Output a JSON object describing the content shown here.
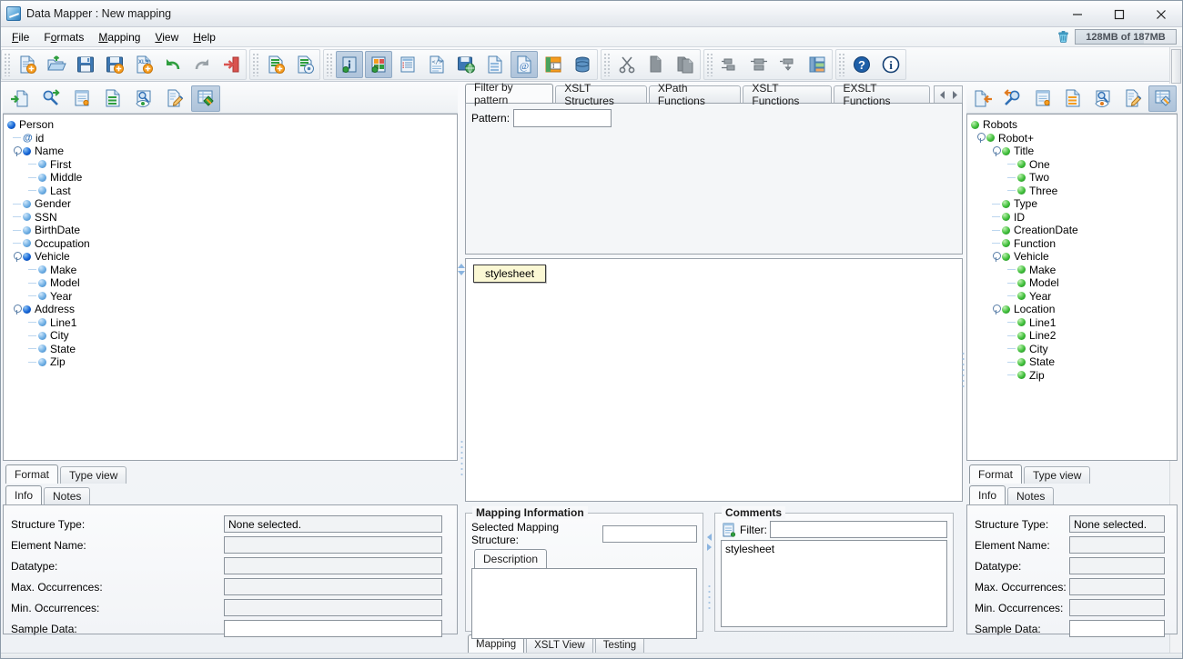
{
  "window": {
    "title": "Data Mapper : New mapping",
    "app_icon": "data-mapper-icon",
    "minimize": "minimize-icon",
    "maximize": "maximize-icon",
    "close": "close-icon"
  },
  "menubar": {
    "items": [
      {
        "label": "File",
        "mnemonic": "F"
      },
      {
        "label": "Formats",
        "mnemonic": "o"
      },
      {
        "label": "Mapping",
        "mnemonic": "M"
      },
      {
        "label": "View",
        "mnemonic": "V"
      },
      {
        "label": "Help",
        "mnemonic": "H"
      }
    ],
    "memory": {
      "text": "128MB of 187MB",
      "trash_icon": "trash-icon"
    }
  },
  "toolbar": {
    "groups": [
      {
        "buttons": [
          {
            "name": "new-mapping-icon",
            "active": false
          },
          {
            "name": "open-mapping-icon",
            "active": false
          },
          {
            "name": "save-mapping-icon",
            "active": false
          },
          {
            "name": "save-as-mapping-icon",
            "active": false
          },
          {
            "name": "export-xls-icon",
            "active": false
          },
          {
            "name": "undo-icon",
            "active": false
          },
          {
            "name": "redo-icon",
            "active": false
          },
          {
            "name": "exit-icon",
            "active": false
          }
        ]
      },
      {
        "buttons": [
          {
            "name": "add-structure-icon",
            "active": false
          },
          {
            "name": "remove-structure-icon",
            "active": false
          }
        ]
      },
      {
        "buttons": [
          {
            "name": "source-info-icon",
            "active": true
          },
          {
            "name": "target-info-icon",
            "active": true
          },
          {
            "name": "list-view-icon",
            "active": false
          },
          {
            "name": "xml-source-icon",
            "active": false
          },
          {
            "name": "save-web-icon",
            "active": false
          },
          {
            "name": "document-icon",
            "active": false
          },
          {
            "name": "at-document-icon",
            "active": true
          },
          {
            "name": "text-annotation-icon",
            "active": false
          },
          {
            "name": "database-icon",
            "active": false
          }
        ]
      },
      {
        "buttons": [
          {
            "name": "cut-icon",
            "active": false
          },
          {
            "name": "copy-icon",
            "active": false
          },
          {
            "name": "paste-icon",
            "active": false
          }
        ]
      },
      {
        "buttons": [
          {
            "name": "align-left-icon",
            "active": false
          },
          {
            "name": "align-center-icon",
            "active": false
          },
          {
            "name": "align-right-icon",
            "active": false
          },
          {
            "name": "grid-layout-icon",
            "active": false
          }
        ]
      },
      {
        "buttons": [
          {
            "name": "help-icon",
            "active": false
          },
          {
            "name": "about-icon",
            "active": false
          }
        ]
      }
    ]
  },
  "left_panel": {
    "toolbar": [
      {
        "name": "import-structure-icon",
        "active": false
      },
      {
        "name": "find-structure-icon",
        "active": false
      },
      {
        "name": "new-note-icon",
        "active": false
      },
      {
        "name": "structure-list-icon",
        "active": false
      },
      {
        "name": "preview-structure-icon",
        "active": false
      },
      {
        "name": "edit-structure-icon",
        "active": false
      },
      {
        "name": "structure-view-icon",
        "active": true
      }
    ],
    "tree": [
      {
        "label": "Person",
        "depth": 0,
        "dot": "dark-blue",
        "handle": false,
        "attr": false
      },
      {
        "label": "id",
        "depth": 1,
        "dot": "attr",
        "handle": false,
        "attr": true
      },
      {
        "label": "Name",
        "depth": 1,
        "dot": "dark-blue",
        "handle": true,
        "attr": false
      },
      {
        "label": "First",
        "depth": 2,
        "dot": "light-blue",
        "handle": false,
        "attr": false
      },
      {
        "label": "Middle",
        "depth": 2,
        "dot": "light-blue",
        "handle": false,
        "attr": false
      },
      {
        "label": "Last",
        "depth": 2,
        "dot": "light-blue",
        "handle": false,
        "attr": false
      },
      {
        "label": "Gender",
        "depth": 1,
        "dot": "light-blue",
        "handle": false,
        "attr": false
      },
      {
        "label": "SSN",
        "depth": 1,
        "dot": "light-blue",
        "handle": false,
        "attr": false
      },
      {
        "label": "BirthDate",
        "depth": 1,
        "dot": "light-blue",
        "handle": false,
        "attr": false
      },
      {
        "label": "Occupation",
        "depth": 1,
        "dot": "light-blue",
        "handle": false,
        "attr": false
      },
      {
        "label": "Vehicle",
        "depth": 1,
        "dot": "dark-blue",
        "handle": true,
        "attr": false
      },
      {
        "label": "Make",
        "depth": 2,
        "dot": "light-blue",
        "handle": false,
        "attr": false
      },
      {
        "label": "Model",
        "depth": 2,
        "dot": "light-blue",
        "handle": false,
        "attr": false
      },
      {
        "label": "Year",
        "depth": 2,
        "dot": "light-blue",
        "handle": false,
        "attr": false
      },
      {
        "label": "Address",
        "depth": 1,
        "dot": "dark-blue",
        "handle": true,
        "attr": false
      },
      {
        "label": "Line1",
        "depth": 2,
        "dot": "light-blue",
        "handle": false,
        "attr": false
      },
      {
        "label": "City",
        "depth": 2,
        "dot": "light-blue",
        "handle": false,
        "attr": false
      },
      {
        "label": "State",
        "depth": 2,
        "dot": "light-blue",
        "handle": false,
        "attr": false
      },
      {
        "label": "Zip",
        "depth": 2,
        "dot": "light-blue",
        "handle": false,
        "attr": false
      }
    ],
    "view_tabs": [
      {
        "label": "Format",
        "selected": true
      },
      {
        "label": "Type view",
        "selected": false
      }
    ],
    "info_tabs": [
      {
        "label": "Info",
        "selected": true
      },
      {
        "label": "Notes",
        "selected": false
      }
    ],
    "info_fields": [
      {
        "label": "Structure Type:",
        "value": "None selected.",
        "editable": false
      },
      {
        "label": "Element Name:",
        "value": "",
        "editable": false
      },
      {
        "label": "Datatype:",
        "value": "",
        "editable": false
      },
      {
        "label": "Max. Occurrences:",
        "value": "",
        "editable": false
      },
      {
        "label": "Min. Occurrences:",
        "value": "",
        "editable": false
      },
      {
        "label": "Sample Data:",
        "value": "",
        "editable": true
      }
    ]
  },
  "center_panel": {
    "tabs": [
      {
        "label": "Filter by pattern",
        "selected": true
      },
      {
        "label": "XSLT Structures",
        "selected": false
      },
      {
        "label": "XPath Functions",
        "selected": false
      },
      {
        "label": "XSLT Functions",
        "selected": false
      },
      {
        "label": "EXSLT Functions",
        "selected": false
      }
    ],
    "tab_scroll": {
      "prev": "scroll-left-icon",
      "next": "scroll-right-icon"
    },
    "pattern": {
      "label": "Pattern:",
      "value": "",
      "placeholder": ""
    },
    "canvas": {
      "nodes": [
        {
          "label": "stylesheet"
        }
      ]
    },
    "mapping_information": {
      "title": "Mapping Information",
      "selected_label": "Selected Mapping Structure:",
      "selected_value": "",
      "description_tab": "Description",
      "description_value": ""
    },
    "comments": {
      "title": "Comments",
      "filter_icon": "comments-filter-icon",
      "filter_label": "Filter:",
      "filter_value": "",
      "lines": [
        "stylesheet"
      ]
    },
    "bottom_tabs": [
      {
        "label": "Mapping",
        "selected": true
      },
      {
        "label": "XSLT View",
        "selected": false
      },
      {
        "label": "Testing",
        "selected": false
      }
    ]
  },
  "right_panel": {
    "toolbar": [
      {
        "name": "import-structure-icon",
        "active": false
      },
      {
        "name": "find-structure-icon",
        "active": false
      },
      {
        "name": "new-note-icon",
        "active": false
      },
      {
        "name": "structure-list-icon",
        "active": false
      },
      {
        "name": "preview-structure-icon",
        "active": false
      },
      {
        "name": "edit-structure-icon",
        "active": false
      },
      {
        "name": "structure-view-icon",
        "active": true
      }
    ],
    "tree": [
      {
        "label": "Robots",
        "depth": 0,
        "dot": "green",
        "handle": false
      },
      {
        "label": "Robot+",
        "depth": 1,
        "dot": "green",
        "handle": true
      },
      {
        "label": "Title",
        "depth": 2,
        "dot": "green",
        "handle": true
      },
      {
        "label": "One",
        "depth": 3,
        "dot": "green",
        "handle": false
      },
      {
        "label": "Two",
        "depth": 3,
        "dot": "green",
        "handle": false
      },
      {
        "label": "Three",
        "depth": 3,
        "dot": "green",
        "handle": false
      },
      {
        "label": "Type",
        "depth": 2,
        "dot": "green",
        "handle": false
      },
      {
        "label": "ID",
        "depth": 2,
        "dot": "green",
        "handle": false
      },
      {
        "label": "CreationDate",
        "depth": 2,
        "dot": "green",
        "handle": false
      },
      {
        "label": "Function",
        "depth": 2,
        "dot": "green",
        "handle": false
      },
      {
        "label": "Vehicle",
        "depth": 2,
        "dot": "green",
        "handle": true
      },
      {
        "label": "Make",
        "depth": 3,
        "dot": "green",
        "handle": false
      },
      {
        "label": "Model",
        "depth": 3,
        "dot": "green",
        "handle": false
      },
      {
        "label": "Year",
        "depth": 3,
        "dot": "green",
        "handle": false
      },
      {
        "label": "Location",
        "depth": 2,
        "dot": "green",
        "handle": true
      },
      {
        "label": "Line1",
        "depth": 3,
        "dot": "green",
        "handle": false
      },
      {
        "label": "Line2",
        "depth": 3,
        "dot": "green",
        "handle": false
      },
      {
        "label": "City",
        "depth": 3,
        "dot": "green",
        "handle": false
      },
      {
        "label": "State",
        "depth": 3,
        "dot": "green",
        "handle": false
      },
      {
        "label": "Zip",
        "depth": 3,
        "dot": "green",
        "handle": false
      }
    ],
    "view_tabs": [
      {
        "label": "Format",
        "selected": true
      },
      {
        "label": "Type view",
        "selected": false
      }
    ],
    "info_tabs": [
      {
        "label": "Info",
        "selected": true
      },
      {
        "label": "Notes",
        "selected": false
      }
    ],
    "info_fields": [
      {
        "label": "Structure Type:",
        "value": "None selected.",
        "editable": false
      },
      {
        "label": "Element Name:",
        "value": "",
        "editable": false
      },
      {
        "label": "Datatype:",
        "value": "",
        "editable": false
      },
      {
        "label": "Max. Occurrences:",
        "value": "",
        "editable": false
      },
      {
        "label": "Min. Occurrences:",
        "value": "",
        "editable": false
      },
      {
        "label": "Sample Data:",
        "value": "",
        "editable": true
      }
    ]
  },
  "colors": {
    "accent_blue": "#1565d8",
    "target_green": "#3fbf3a",
    "node_chip_bg": "#fbf8d4",
    "toolbar_active": "#aec3da"
  }
}
